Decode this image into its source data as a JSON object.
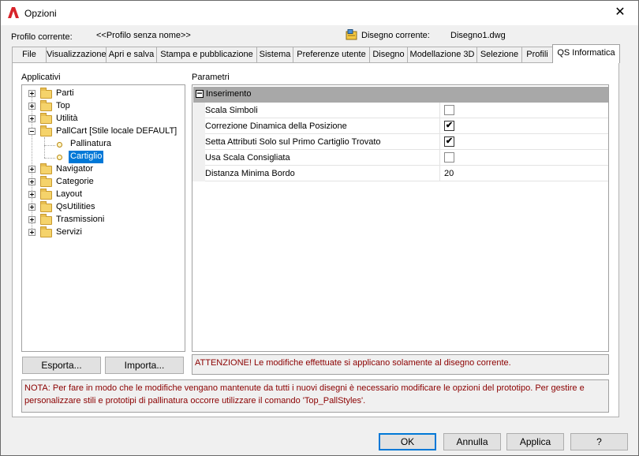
{
  "window": {
    "title": "Opzioni",
    "close_glyph": "✕",
    "app_icon": "autocad-logo-icon"
  },
  "profile": {
    "label": "Profilo corrente:",
    "value": "<<Profilo senza nome>>"
  },
  "drawing": {
    "label": "Disegno corrente:",
    "value": "Disegno1.dwg",
    "icon": "drawing-file-icon"
  },
  "tabs": [
    {
      "label": "File"
    },
    {
      "label": "Visualizzazione"
    },
    {
      "label": "Apri e salva"
    },
    {
      "label": "Stampa e pubblicazione"
    },
    {
      "label": "Sistema"
    },
    {
      "label": "Preferenze utente"
    },
    {
      "label": "Disegno"
    },
    {
      "label": "Modellazione 3D"
    },
    {
      "label": "Selezione"
    },
    {
      "label": "Profili"
    },
    {
      "label": "QS Informatica"
    }
  ],
  "active_tab": "QS Informatica",
  "left": {
    "title": "Applicativi",
    "tree": [
      {
        "label": "Parti"
      },
      {
        "label": "Top"
      },
      {
        "label": "Utilità"
      },
      {
        "label": "PallCart [Stile locale DEFAULT]"
      },
      {
        "label": "Pallinatura"
      },
      {
        "label": "Cartiglio"
      },
      {
        "label": "Navigator"
      },
      {
        "label": "Categorie"
      },
      {
        "label": "Layout"
      },
      {
        "label": "QsUtilities"
      },
      {
        "label": "Trasmissioni"
      },
      {
        "label": "Servizi"
      }
    ],
    "selected": "Cartiglio",
    "export_button": "Esporta...",
    "import_button": "Importa..."
  },
  "right": {
    "title": "Parametri",
    "category": {
      "label": "Inserimento",
      "collapse_glyph": "−"
    },
    "rows": [
      {
        "name": "Scala Simboli",
        "value": ""
      },
      {
        "name": "Correzione Dinamica della Posizione",
        "value": "✔"
      },
      {
        "name": "Setta Attributi Solo sul Primo Cartiglio Trovato",
        "value": "✔"
      },
      {
        "name": "Usa Scala Consigliata",
        "value": ""
      },
      {
        "name": "Distanza Minima Bordo",
        "value": "20"
      }
    ],
    "warning": "ATTENZIONE! Le modifiche effettuate si applicano solamente al disegno corrente."
  },
  "note": "NOTA: Per fare in modo che le modifiche vengano mantenute da tutti i nuovi disegni è necessario modificare le opzioni del prototipo. Per gestire e personalizzare stili e prototipi di pallinatura occorre utilizzare il comando 'Top_PallStyles'.",
  "buttons": {
    "ok": "OK",
    "cancel": "Annulla",
    "apply": "Applica",
    "help": "?"
  },
  "colors": {
    "accent": "#0078d7",
    "warning_text": "#8b0000",
    "folder": "#f5d36b"
  }
}
